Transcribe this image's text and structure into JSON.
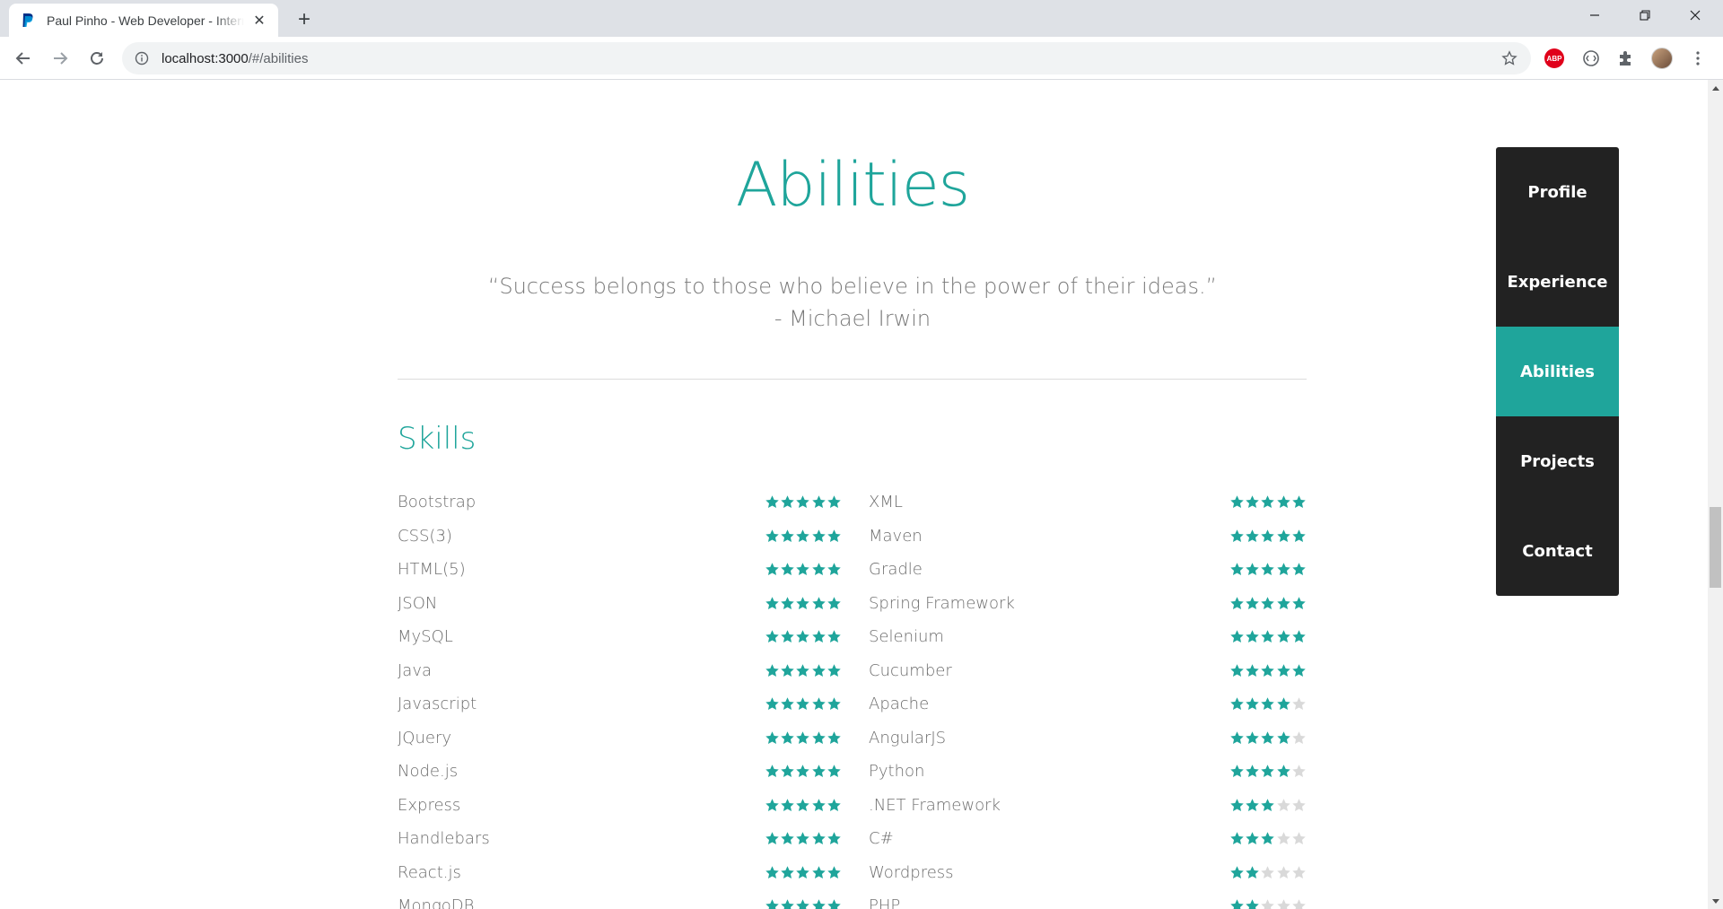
{
  "browser": {
    "tab_title": "Paul Pinho - Web Developer - Intern",
    "url_host": "localhost:3000",
    "url_path": "/#/abilities",
    "new_tab_symbol": "+",
    "close_symbol": "✕",
    "abp_label": "ABP"
  },
  "page": {
    "title": "Abilities",
    "quote_line1": "“Success belongs to those who believe in the power of their ideas.”",
    "quote_line2": "- Michael Irwin",
    "skills_heading": "Skills"
  },
  "colors": {
    "accent": "#1fa59b",
    "star_empty": "#d9d9d9",
    "nav_bg": "#222222"
  },
  "skills_left": [
    {
      "name": "Bootstrap",
      "rating": 5
    },
    {
      "name": "CSS(3)",
      "rating": 5
    },
    {
      "name": "HTML(5)",
      "rating": 5
    },
    {
      "name": "JSON",
      "rating": 5
    },
    {
      "name": "MySQL",
      "rating": 5
    },
    {
      "name": "Java",
      "rating": 5
    },
    {
      "name": "Javascript",
      "rating": 5
    },
    {
      "name": "JQuery",
      "rating": 5
    },
    {
      "name": "Node.js",
      "rating": 5
    },
    {
      "name": "Express",
      "rating": 5
    },
    {
      "name": "Handlebars",
      "rating": 5
    },
    {
      "name": "React.js",
      "rating": 5
    },
    {
      "name": "MongoDB",
      "rating": 5
    }
  ],
  "skills_right": [
    {
      "name": "XML",
      "rating": 5
    },
    {
      "name": "Maven",
      "rating": 5
    },
    {
      "name": "Gradle",
      "rating": 5
    },
    {
      "name": "Spring Framework",
      "rating": 5
    },
    {
      "name": "Selenium",
      "rating": 5
    },
    {
      "name": "Cucumber",
      "rating": 5
    },
    {
      "name": "Apache",
      "rating": 4
    },
    {
      "name": "AngularJS",
      "rating": 4
    },
    {
      "name": "Python",
      "rating": 4
    },
    {
      "name": ".NET Framework",
      "rating": 3
    },
    {
      "name": "C#",
      "rating": 3
    },
    {
      "name": "Wordpress",
      "rating": 2
    },
    {
      "name": "PHP",
      "rating": 2
    }
  ],
  "sidenav": [
    {
      "label": "Profile",
      "active": false
    },
    {
      "label": "Experience",
      "active": false
    },
    {
      "label": "Abilities",
      "active": true
    },
    {
      "label": "Projects",
      "active": false
    },
    {
      "label": "Contact",
      "active": false
    }
  ]
}
